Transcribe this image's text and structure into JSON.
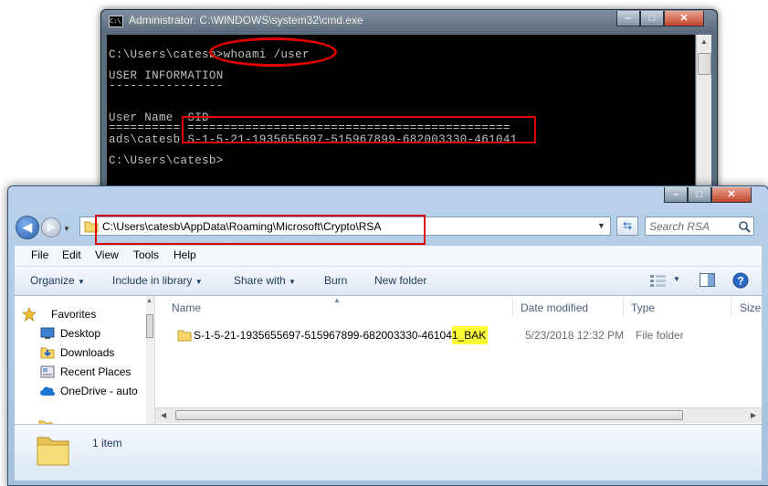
{
  "cmd": {
    "icon_text": "C:\\",
    "title": "Administrator: C:\\WINDOWS\\system32\\cmd.exe",
    "controls": {
      "minimize": "–",
      "maximize": "□",
      "close": "✕"
    },
    "lines": [
      "C:\\Users\\catesb>whoami /user",
      "",
      "USER INFORMATION",
      "----------------",
      "",
      "User Name  SID",
      "========== =============================================",
      "ads\\catesb S-1-5-21-1935655697-515967899-682003330-461041",
      "",
      "C:\\Users\\catesb>"
    ]
  },
  "explorer": {
    "controls": {
      "minimize": "–",
      "maximize": "□",
      "close": "✕"
    },
    "address": "C:\\Users\\catesb\\AppData\\Roaming\\Microsoft\\Crypto\\RSA",
    "search_placeholder": "Search RSA",
    "menu": [
      "File",
      "Edit",
      "View",
      "Tools",
      "Help"
    ],
    "toolbar": {
      "organize": "Organize",
      "include": "Include in library",
      "share": "Share with",
      "burn": "Burn",
      "new_folder": "New folder"
    },
    "nav": {
      "favorites": "Favorites",
      "items": [
        "Desktop",
        "Downloads",
        "Recent Places",
        "OneDrive - auto"
      ]
    },
    "columns": {
      "name": "Name",
      "date": "Date modified",
      "type": "Type",
      "size": "Size"
    },
    "files": [
      {
        "name_main": "S-1-5-21-1935655697-515967899-682003330-46104",
        "name_highlight": "1_BAK",
        "date": "5/23/2018 12:32 PM",
        "type": "File folder"
      }
    ],
    "status": "1 item"
  },
  "colors": {
    "annotation_red": "#e00000",
    "highlight_yellow": "#ffff33",
    "console_text": "#c0c0c0",
    "console_bg": "#000000"
  }
}
